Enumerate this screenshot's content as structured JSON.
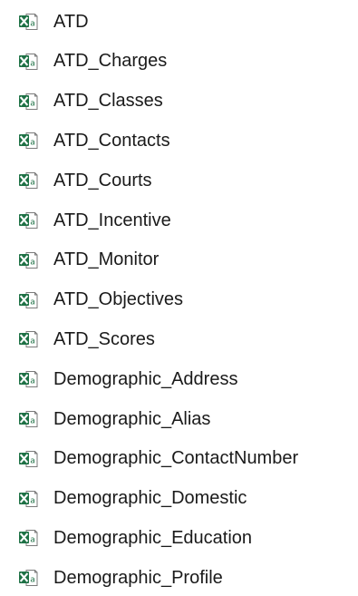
{
  "file_list": {
    "icon": "excel-csv-file-icon",
    "colors": {
      "excel_green": "#1e7145",
      "text": "#1a1a1a"
    },
    "items": [
      {
        "name": "ATD"
      },
      {
        "name": "ATD_Charges"
      },
      {
        "name": "ATD_Classes"
      },
      {
        "name": "ATD_Contacts"
      },
      {
        "name": "ATD_Courts"
      },
      {
        "name": "ATD_Incentive"
      },
      {
        "name": "ATD_Monitor"
      },
      {
        "name": "ATD_Objectives"
      },
      {
        "name": "ATD_Scores"
      },
      {
        "name": "Demographic_Address"
      },
      {
        "name": "Demographic_Alias"
      },
      {
        "name": "Demographic_ContactNumber"
      },
      {
        "name": "Demographic_Domestic"
      },
      {
        "name": "Demographic_Education"
      },
      {
        "name": "Demographic_Profile"
      }
    ]
  }
}
